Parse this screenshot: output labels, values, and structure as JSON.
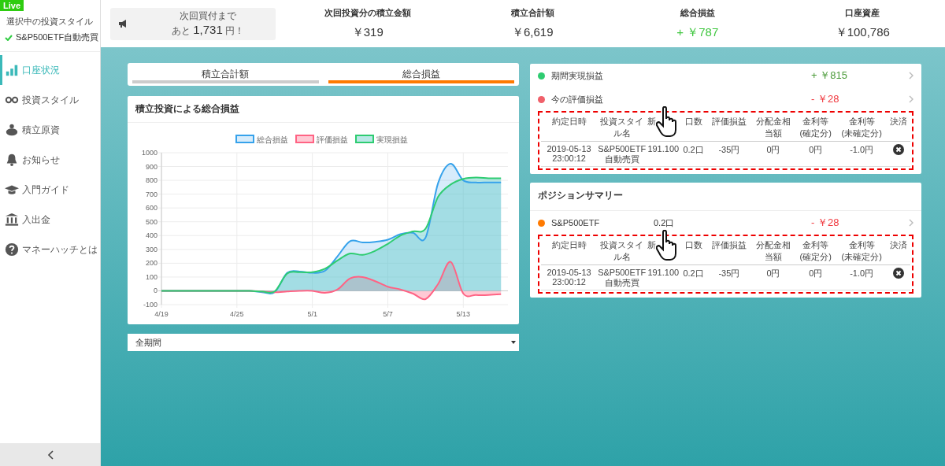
{
  "sidebar": {
    "badge": "Live",
    "style_label": "選択中の投資スタイル",
    "style_value": "S&P500ETF自動売買",
    "items": [
      {
        "label": "口座状況",
        "selected": true
      },
      {
        "label": "投資スタイル",
        "selected": false
      },
      {
        "label": "積立原資",
        "selected": false
      },
      {
        "label": "お知らせ",
        "selected": false
      },
      {
        "label": "入門ガイド",
        "selected": false
      },
      {
        "label": "入出金",
        "selected": false
      },
      {
        "label": "マネーハッチとは",
        "selected": false
      }
    ]
  },
  "header": {
    "notice": {
      "line1": "次回買付まで",
      "prefix": "あと",
      "amount": "1,731",
      "suffix": "円！"
    },
    "stats": [
      {
        "label": "次回投資分の積立金額",
        "value": "￥319",
        "positive": false
      },
      {
        "label": "積立合計額",
        "value": "￥6,619",
        "positive": false
      },
      {
        "label": "総合損益",
        "value": "+ ￥787",
        "positive": true
      },
      {
        "label": "口座資産",
        "value": "￥100,786",
        "positive": false
      }
    ]
  },
  "tabs": [
    {
      "label": "積立合計額",
      "selected": false
    },
    {
      "label": "総合損益",
      "selected": true
    }
  ],
  "chart_card": {
    "title": "積立投資による総合損益",
    "chart_data": {
      "type": "area",
      "categories": [
        "4/19",
        null,
        null,
        null,
        null,
        null,
        "4/25",
        null,
        null,
        null,
        null,
        null,
        "5/1",
        null,
        null,
        null,
        null,
        null,
        "5/7",
        null,
        null,
        null,
        null,
        null,
        "5/13",
        null,
        null,
        null
      ],
      "ylim": [
        -100,
        1000
      ],
      "yticks": [
        -100,
        0,
        100,
        200,
        300,
        400,
        500,
        600,
        700,
        800,
        900,
        1000
      ],
      "grid": true,
      "legend": true,
      "series": [
        {
          "name": "総合損益",
          "color": "#36a2eb",
          "values": [
            0,
            0,
            0,
            0,
            0,
            0,
            0,
            0,
            -10,
            -10,
            130,
            140,
            130,
            145,
            250,
            360,
            350,
            355,
            370,
            410,
            420,
            385,
            780,
            920,
            800,
            785,
            785,
            785
          ]
        },
        {
          "name": "評価損益",
          "color": "#ff6384",
          "values": [
            0,
            0,
            0,
            0,
            0,
            0,
            0,
            0,
            -5,
            -10,
            -5,
            0,
            0,
            -15,
            10,
            90,
            100,
            70,
            30,
            10,
            -20,
            -60,
            50,
            210,
            -20,
            -30,
            -30,
            -25
          ]
        },
        {
          "name": "実現損益",
          "color": "#2ecc71",
          "values": [
            0,
            0,
            0,
            0,
            0,
            0,
            0,
            0,
            -5,
            -5,
            125,
            135,
            135,
            160,
            220,
            270,
            260,
            290,
            340,
            400,
            430,
            450,
            680,
            770,
            810,
            820,
            815,
            815
          ]
        }
      ]
    }
  },
  "period_select": {
    "value": "全期間"
  },
  "pnl_card": {
    "rows": [
      {
        "label": "期間実現損益",
        "value": "+ ￥815",
        "color": "#2ecc71",
        "positive": true
      },
      {
        "label": "今の評価損益",
        "value": "- ￥28",
        "color": "#f0606a",
        "positive": false
      }
    ],
    "table": {
      "columns": [
        "約定日時",
        "投資スタイル名",
        "新",
        "口数",
        "評価損益",
        "分配金相当額",
        "金利等\n(確定分)",
        "金利等\n(未確定分)",
        "決済"
      ],
      "rows": [
        [
          "2019-05-13\n23:00:12",
          "S&P500ETF\n自動売買",
          "191.100",
          "0.2口",
          "-35円",
          "0円",
          "0円",
          "-1.0円"
        ]
      ]
    }
  },
  "positions_card": {
    "title": "ポジションサマリー",
    "rows": [
      {
        "label": "S&P500ETF",
        "qty": "0.2口",
        "value": "- ￥28",
        "color": "#ff7a00",
        "positive": false
      }
    ],
    "table": {
      "columns": [
        "約定日時",
        "投資スタイル名",
        "新",
        "口数",
        "評価損益",
        "分配金相当額",
        "金利等\n(確定分)",
        "金利等\n(未確定分)",
        "決済"
      ],
      "rows": [
        [
          "2019-05-13\n23:00:12",
          "S&P500ETF\n自動売買",
          "191.100",
          "0.2口",
          "-35円",
          "0円",
          "0円",
          "-1.0円"
        ]
      ]
    }
  }
}
